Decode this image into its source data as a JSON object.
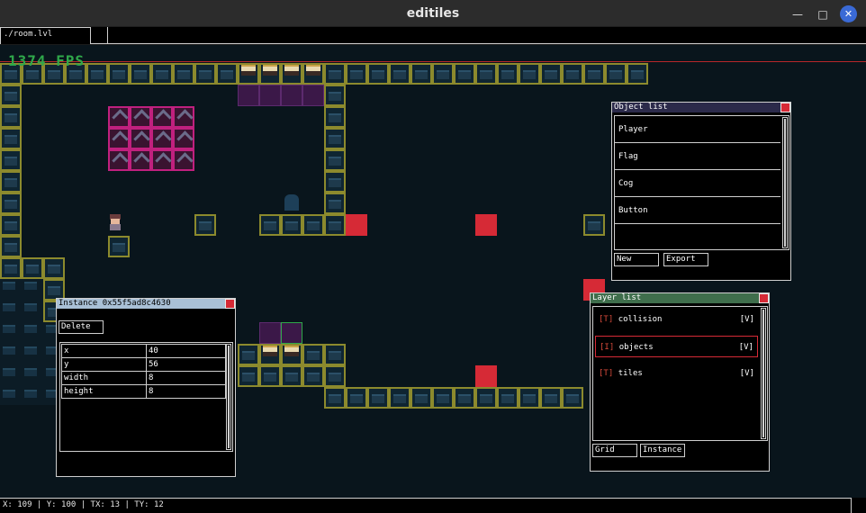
{
  "window": {
    "title": "editiles"
  },
  "tabs": [
    {
      "label": "./room.lvl"
    }
  ],
  "viewport": {
    "fps": "1374 FPS"
  },
  "object_list": {
    "title": "Object list",
    "items": [
      "Player",
      "Flag",
      "Cog",
      "Button"
    ],
    "buttons": {
      "new": "New",
      "export": "Export"
    }
  },
  "instance": {
    "title": "Instance 0x55f5ad8c4630",
    "delete_label": "Delete",
    "properties": [
      {
        "key": "x",
        "value": "40"
      },
      {
        "key": "y",
        "value": "56"
      },
      {
        "key": "width",
        "value": "8"
      },
      {
        "key": "height",
        "value": "8"
      }
    ]
  },
  "layer_list": {
    "title": "Layer list",
    "layers": [
      {
        "tag": "[T]",
        "name": "collision",
        "visible": "[V]"
      },
      {
        "tag": "[I]",
        "name": "objects",
        "visible": "[V]",
        "selected": true
      },
      {
        "tag": "[T]",
        "name": "tiles",
        "visible": "[V]"
      }
    ],
    "buttons": {
      "grid": "Grid",
      "instance": "Instance"
    }
  },
  "statusbar": {
    "text": "X: 109 | Y: 100 | TX: 13 | TY: 12"
  },
  "colors": {
    "object_panel_header": "#2b2a4a",
    "instance_panel_header": "#a9c0d6",
    "layer_panel_header": "#3f6e4c",
    "close_button": "#d62a36",
    "fps_text": "#2fa84a"
  }
}
